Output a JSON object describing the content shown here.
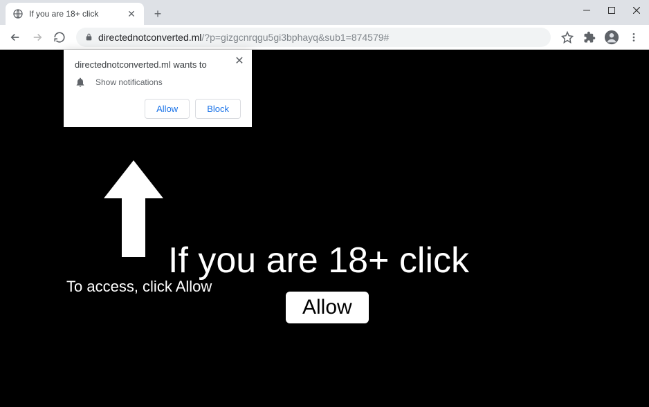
{
  "tab": {
    "title": "If you are 18+ click"
  },
  "url": {
    "domain": "directednotconverted.ml",
    "path": "/?p=gizgcnrqgu5gi3bphayq&sub1=874579#"
  },
  "notification": {
    "title": "directednotconverted.ml wants to",
    "permission": "Show notifications",
    "allow": "Allow",
    "block": "Block"
  },
  "page": {
    "headline": "If you are 18+ click",
    "subtext": "To access, click Allow",
    "button": "Allow"
  }
}
